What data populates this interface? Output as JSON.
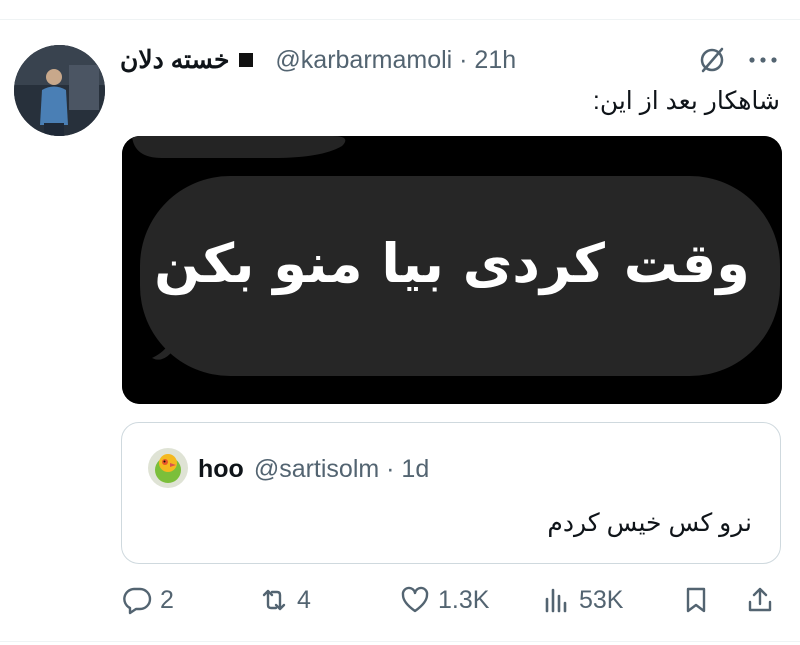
{
  "tweet": {
    "display_name": "خسته دلان",
    "handle_time": "@karbarmamoli · 21h",
    "text": "شاهکار بعد از این:",
    "media_caption": "وقت کردی بیا منو بکن"
  },
  "quote": {
    "name": "hoo",
    "handle_time": "@sartisolm · 1d",
    "text": "نرو کس خیس کردم"
  },
  "actions": {
    "replies": "2",
    "retweets": "4",
    "likes": "1.3K",
    "views": "53K"
  },
  "icons": {
    "reply": "reply-icon",
    "retweet": "retweet-icon",
    "like": "heart-icon",
    "views": "views-icon",
    "bookmark": "bookmark-icon",
    "share": "share-icon",
    "more": "more-icon",
    "grok": "grok-icon"
  },
  "colors": {
    "text": "#0f1419",
    "secondary": "#536471",
    "border": "#cfd9de",
    "media_bg": "#000000"
  }
}
